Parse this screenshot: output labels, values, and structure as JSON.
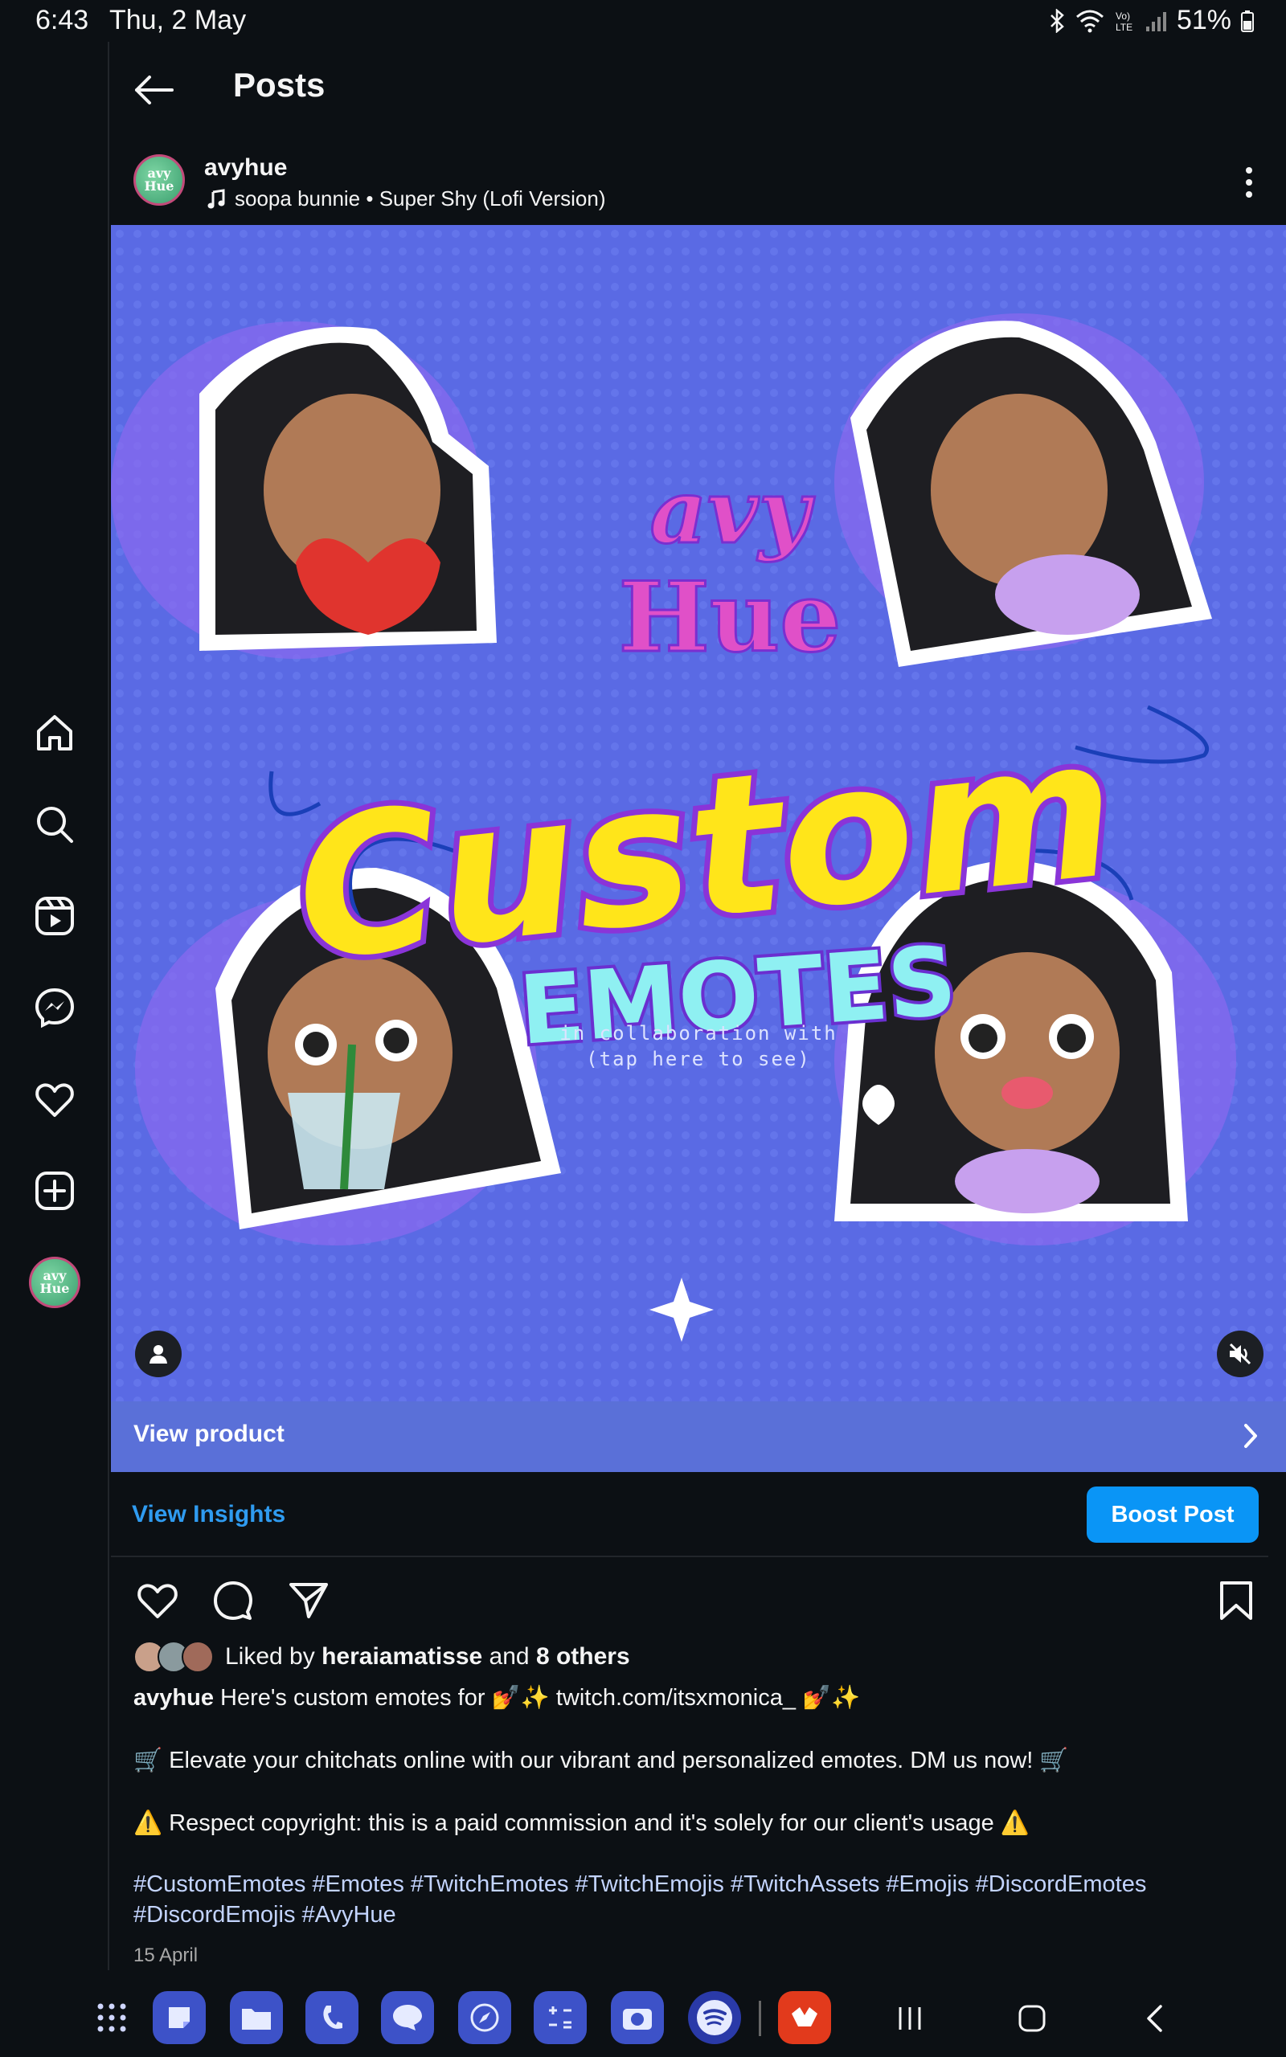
{
  "status": {
    "time": "6:43",
    "date": "Thu, 2 May",
    "battery": "51%"
  },
  "header": {
    "title": "Posts"
  },
  "post": {
    "username": "avyhue",
    "music": "soopa bunnie • Super Shy (Lofi Version)",
    "image_text": {
      "brand": "avy Hue",
      "headline": "Custom",
      "subhead": "EMOTES",
      "collab_line1": "in collaboration with",
      "collab_line2": "(tap here to see)"
    },
    "product_label": "View product",
    "insights_label": "View Insights",
    "boost_label": "Boost Post",
    "likes": {
      "prefix": "Liked by ",
      "user": "heraiamatisse",
      "middle": " and ",
      "others": "8 others"
    },
    "caption": {
      "username": "avyhue",
      "line1": " Here's custom emotes for 💅✨ twitch.com/itsxmonica_ 💅✨",
      "line2": "🛒 Elevate your chitchats online with our vibrant and personalized emotes. DM us now! 🛒",
      "line3": "⚠️ Respect copyright: this is a paid commission and it's solely for our client's usage ⚠️",
      "hashtags": "#CustomEmotes #Emotes #TwitchEmotes #TwitchEmojis #TwitchAssets #Emojis #DiscordEmotes #DiscordEmojis #AvyHue"
    },
    "date": "15 April"
  },
  "avatar_text": "avy Hue",
  "colors": {
    "background": "#0c1014",
    "accent_blue": "#0a95f6",
    "link_blue": "#2f9bf0",
    "product_bar": "#5a70d8",
    "image_bg": "#5d6fe6"
  },
  "icons": {
    "nav": [
      "home-icon",
      "search-icon",
      "reels-icon",
      "messenger-icon",
      "heart-icon",
      "create-icon",
      "profile-avatar"
    ],
    "actions": [
      "like-icon",
      "comment-icon",
      "share-icon",
      "save-icon"
    ]
  }
}
